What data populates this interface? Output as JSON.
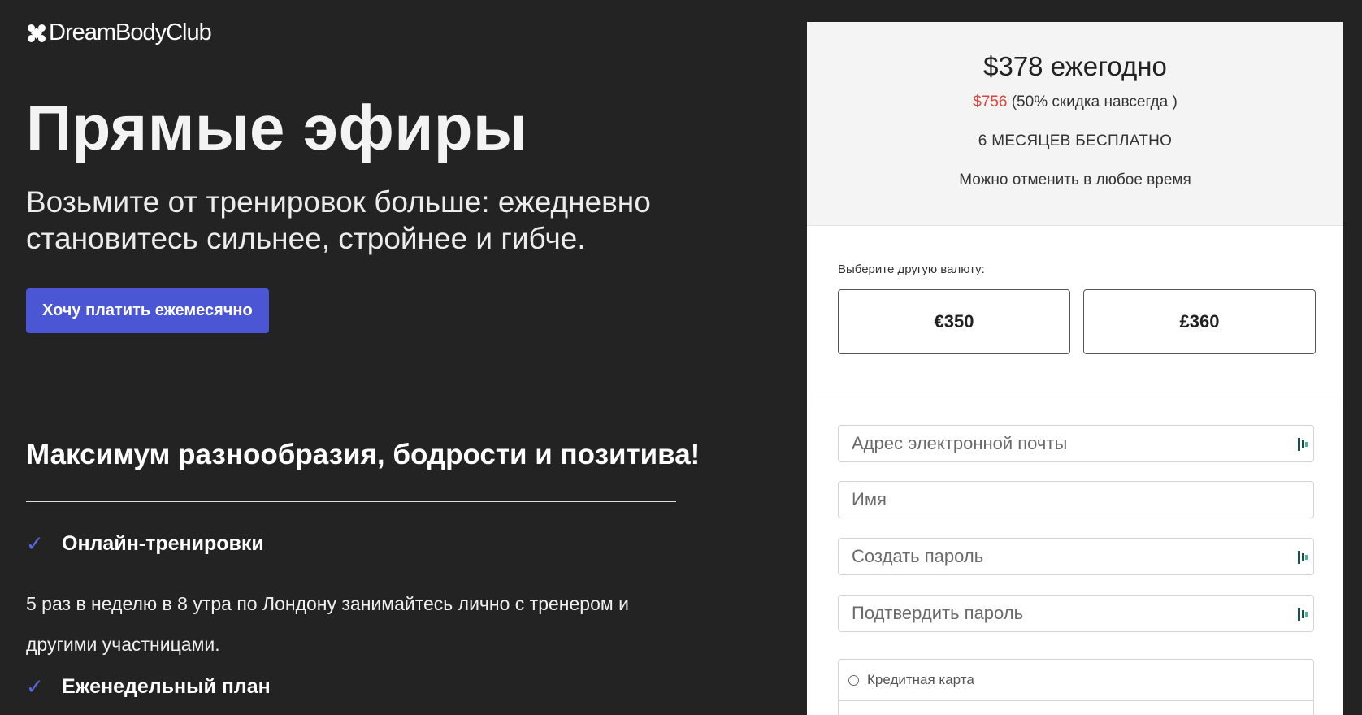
{
  "logo": {
    "text": "DreamBodyClub"
  },
  "hero": {
    "title": "Прямые эфиры",
    "subtitle": "Возьмите от тренировок больше: ежедневно становитесь сильнее, стройнее и гибче.",
    "monthly_button": "Хочу платить ежемесячно"
  },
  "section": {
    "title": "Максимум разнообразия, бодрости и позитива!"
  },
  "features": [
    {
      "title": "Онлайн-тренировки",
      "description": "5 раз в неделю в 8 утра по Лондону занимайтесь лично с тренером и другими участницами."
    },
    {
      "title": "Еженедельный план"
    }
  ],
  "pricing": {
    "price": "$378 ежегодно",
    "old_price": "$756 ",
    "discount": "(50% скидка навсегда )",
    "free_months": "6 МЕСЯЦЕВ БЕСПЛАТНО",
    "cancel_note": "Можно отменить в любое время"
  },
  "currency": {
    "label": "Выберите другую валюту:",
    "options": [
      "€350",
      "£360"
    ]
  },
  "form": {
    "email_placeholder": "Адрес электронной почты",
    "name_placeholder": "Имя",
    "password_placeholder": "Создать пароль",
    "confirm_placeholder": "Подтвердить пароль"
  },
  "payment": {
    "options": [
      "Кредитная карта"
    ]
  },
  "colors": {
    "accent": "#4a56d4",
    "check": "#5b68e6",
    "background": "#232323",
    "strike": "#d9463e"
  }
}
